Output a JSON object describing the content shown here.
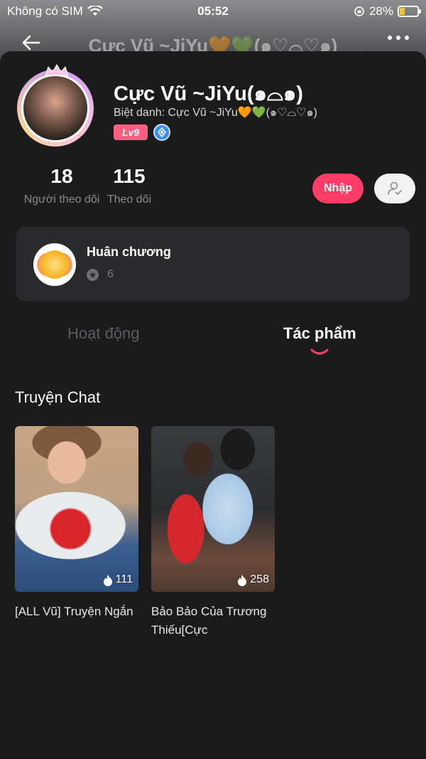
{
  "status_bar": {
    "carrier": "Không có SIM",
    "time": "05:52",
    "battery": "28%",
    "battery_level": 0.28
  },
  "nav": {
    "title": "Cực Vũ ~JiYu🧡💚(๑♡⌓♡๑)",
    "back_icon": "arrow-left-icon",
    "more_icon": "more-dots-icon"
  },
  "profile": {
    "name": "Cực Vũ ~JiYu(๑⌓๑)",
    "nickname": "Biệt danh: Cực Vũ ~JiYu🧡💚(๑♡⌓♡๑)",
    "level": "Lv9"
  },
  "stats": {
    "followers_count": "18",
    "followers_label": "Người theo dõi",
    "following_count": "115",
    "following_label": "Theo dõi"
  },
  "actions": {
    "chat_label": "Nhập"
  },
  "medals": {
    "title": "Huân chương",
    "count": "6"
  },
  "tabs": {
    "activity": "Hoạt động",
    "works": "Tác phẩm",
    "active": "works"
  },
  "section": {
    "title": "Truyện Chat"
  },
  "stories": [
    {
      "title": "[ALL Vũ] Truyện Ngắn",
      "views": "111"
    },
    {
      "title": "Bảo Bảo Của Trương Thiếu[Cực",
      "views": "258"
    }
  ],
  "colors": {
    "accent": "#ff3d67",
    "background": "#1b1b1c",
    "card": "#2a2a2c",
    "level_badge": "#ff5f7e",
    "verify_badge": "#3b8ef0"
  }
}
